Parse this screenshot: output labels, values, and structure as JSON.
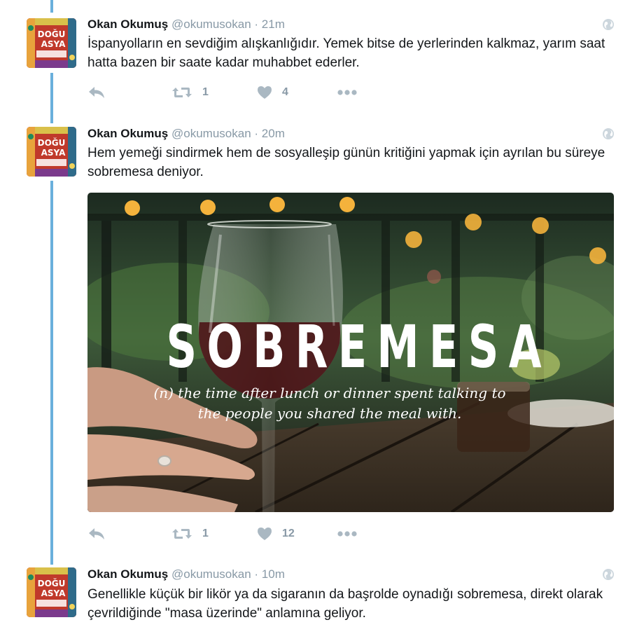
{
  "tweets": [
    {
      "name": "Okan Okumuş",
      "handle": "@okumusokan",
      "separator": "·",
      "time": "21m",
      "text": "İspanyolların en sevdiğim alışkanlığıdır. Yemek bitse de yerlerinden kalkmaz, yarım saat hatta bazen bir saate kadar muhabbet ederler.",
      "retweets": "1",
      "likes": "4"
    },
    {
      "name": "Okan Okumuş",
      "handle": "@okumusokan",
      "separator": "·",
      "time": "20m",
      "text": "Hem yemeği sindirmek hem de sosyalleşip günün kritiğini yapmak için ayrılan bu süreye sobremesa deniyor.",
      "retweets": "1",
      "likes": "12",
      "media": {
        "title": "SOBREMESA",
        "definition": "(n) the time after lunch or dinner spent talking to the people you shared the meal with."
      }
    },
    {
      "name": "Okan Okumuş",
      "handle": "@okumusokan",
      "separator": "·",
      "time": "10m",
      "text": "Genellikle küçük bir likör ya da sigaranın da başrolde oynadığı sobremesa, direkt olarak çevrildiğinde \"masa üzerinde\" anlamına geliyor."
    }
  ],
  "avatar": {
    "text_line1": "DOĞU",
    "text_line2": "ASYA"
  },
  "icons": {
    "reply": "reply-icon",
    "retweet": "retweet-icon",
    "like": "heart-icon",
    "more": "more-icon",
    "globe": "globe-icon"
  },
  "colors": {
    "thread_line": "#6ab0dc",
    "action_icon": "#aab8c2",
    "secondary_text": "#8899a6",
    "primary_text": "#14171a"
  }
}
